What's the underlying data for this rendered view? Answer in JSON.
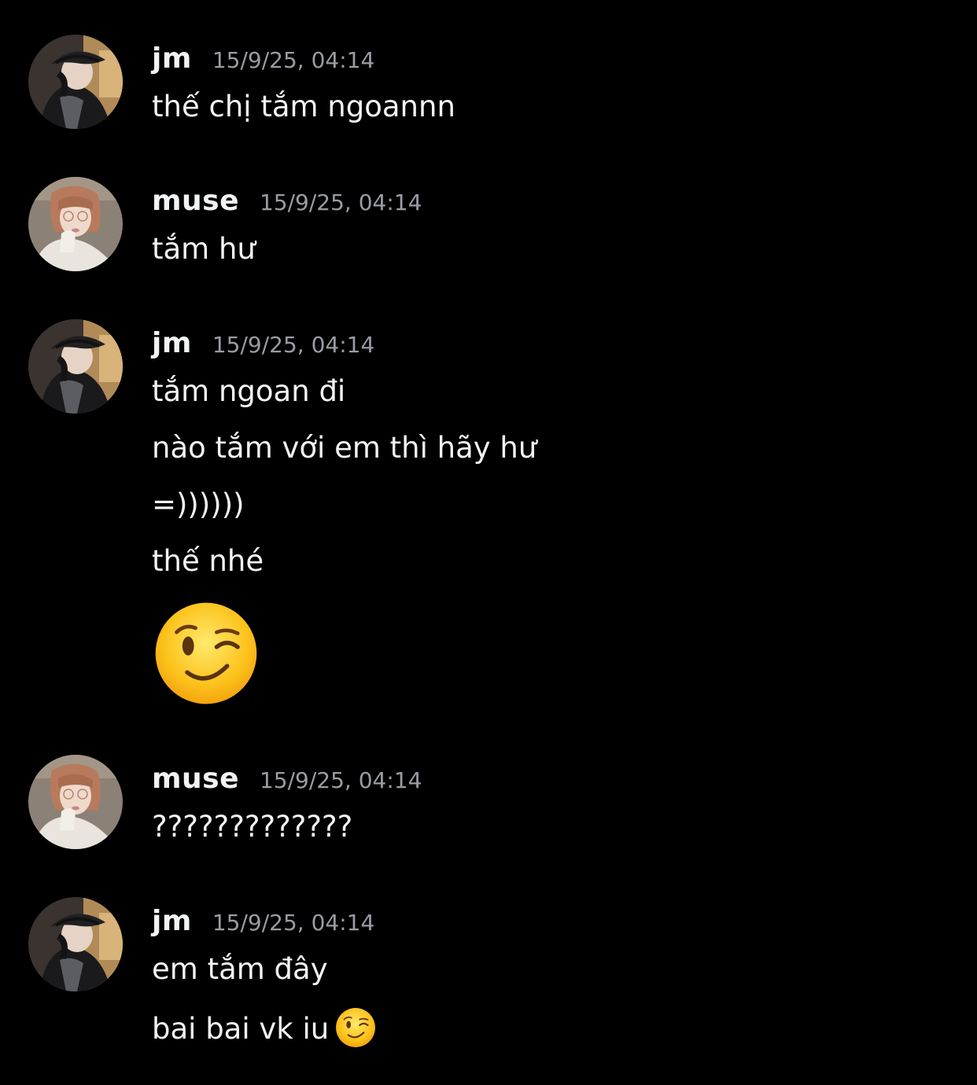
{
  "colors": {
    "background": "#000000",
    "text": "#f2f3f5",
    "timestamp": "#9a9ca3"
  },
  "messages": [
    {
      "author": "jm",
      "avatar": "avatar-jm",
      "timestamp": "15/9/25, 04:14",
      "lines": [
        "thế chị tắm ngoannn"
      ]
    },
    {
      "author": "muse",
      "avatar": "avatar-muse",
      "timestamp": "15/9/25, 04:14",
      "lines": [
        "tắm hư"
      ]
    },
    {
      "author": "jm",
      "avatar": "avatar-jm",
      "timestamp": "15/9/25, 04:14",
      "lines": [
        "tắm ngoan đi",
        "nào tắm với em thì hãy hư",
        "=))))))",
        "thế nhé"
      ],
      "emoji": "winking-face-emoji"
    },
    {
      "author": "muse",
      "avatar": "avatar-muse",
      "timestamp": "15/9/25, 04:14",
      "lines": [
        "?????????????"
      ]
    },
    {
      "author": "jm",
      "avatar": "avatar-jm",
      "timestamp": "15/9/25, 04:14",
      "lines": [
        "em tắm đây",
        "bai bai vk iu"
      ],
      "inline_emoji": "winking-face-emoji"
    }
  ]
}
